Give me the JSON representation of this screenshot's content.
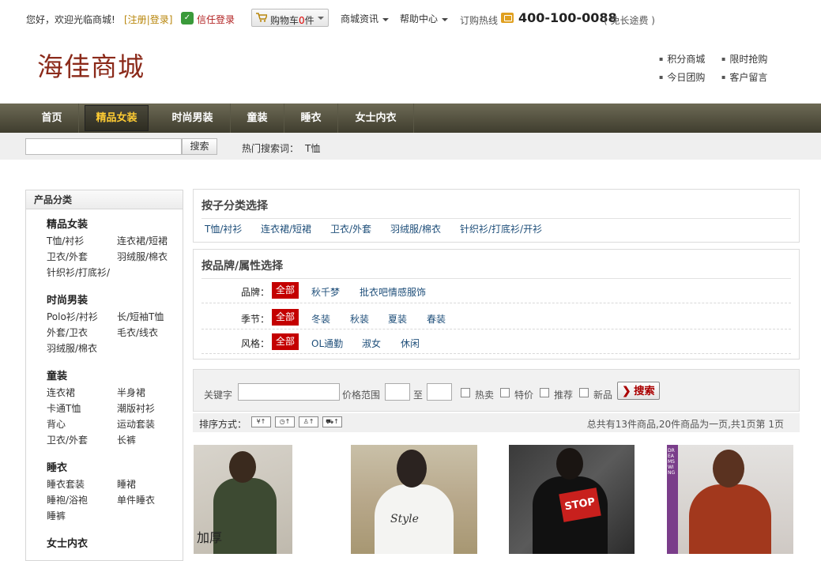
{
  "topbar": {
    "greeting": "您好，欢迎光临商城!",
    "register": "[注册",
    "separator": "|",
    "login": "登录]",
    "trusted_login": "信任登录",
    "cart_label": "购物车",
    "cart_count": "0",
    "cart_unit": "件",
    "menu_news": "商城资讯",
    "menu_help": "帮助中心",
    "hotline_label": "订购热线",
    "hotline_number": "400-100-0088",
    "hotline_note": "( 免长途费 )"
  },
  "header": {
    "logo": "海佳商城",
    "quicklinks": [
      "积分商城",
      "限时抢购",
      "今日团购",
      "客户留言"
    ]
  },
  "nav": {
    "items": [
      "首页",
      "精品女装",
      "时尚男装",
      "童装",
      "睡衣",
      "女士内衣"
    ],
    "active": "精品女装"
  },
  "search": {
    "button": "搜索",
    "hot_label": "热门搜索词：",
    "hot_keyword": "T恤"
  },
  "sidebar": {
    "title": "产品分类",
    "categories": [
      {
        "name": "精品女装",
        "subs": [
          "T恤/衬衫",
          "连衣裙/短裙",
          "卫衣/外套",
          "羽绒服/棉衣",
          "针织衫/打底衫/"
        ]
      },
      {
        "name": "时尚男装",
        "subs": [
          "Polo衫/衬衫",
          "长/短袖T恤",
          "外套/卫衣",
          "毛衣/线衣",
          "羽绒服/棉衣"
        ]
      },
      {
        "name": "童装",
        "subs": [
          "连衣裙",
          "半身裙",
          "卡通T恤",
          "潮版衬衫",
          "背心",
          "运动套装",
          "卫衣/外套",
          "长裤"
        ]
      },
      {
        "name": "睡衣",
        "subs": [
          "睡衣套装",
          "睡裙",
          "睡袍/浴袍",
          "单件睡衣",
          "睡裤"
        ]
      },
      {
        "name": "女士内衣",
        "subs": []
      }
    ]
  },
  "subcat_box": {
    "title": "按子分类选择",
    "items": [
      "T恤/衬衫",
      "连衣裙/短裙",
      "卫衣/外套",
      "羽绒服/棉衣",
      "针织衫/打底衫/开衫"
    ]
  },
  "attr_box": {
    "title": "按品牌/属性选择",
    "all_label": "全部",
    "rows": [
      {
        "label": "品牌：",
        "options": [
          "秋千梦",
          "批衣吧情感服饰"
        ]
      },
      {
        "label": "季节：",
        "options": [
          "冬装",
          "秋装",
          "夏装",
          "春装"
        ]
      },
      {
        "label": "风格：",
        "options": [
          "OL通勤",
          "淑女",
          "休闲"
        ]
      }
    ]
  },
  "search_panel": {
    "keyword_label": "关键字",
    "price_label": "价格范围",
    "to_label": "至",
    "checks": [
      "热卖",
      "特价",
      "推荐",
      "新品"
    ],
    "go_button": "搜索"
  },
  "sortbar": {
    "label": "排序方式：",
    "buttons": [
      "¥↑",
      "◷↑",
      "♙↑",
      "⛟↑"
    ],
    "summary": "总共有13件商品,20件商品为一页,共1页第  1页"
  },
  "products": [
    {
      "badge": "加厚"
    },
    {
      "shirt_text": "Style"
    },
    {
      "shirt_text": "STOP"
    },
    {
      "side_text": "DREAMSWING"
    }
  ]
}
